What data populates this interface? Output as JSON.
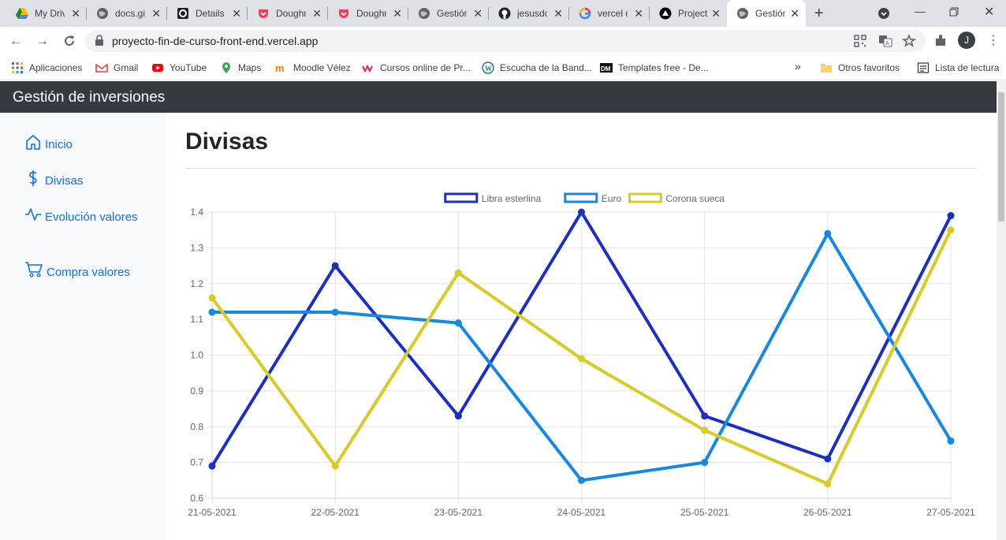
{
  "tabs": [
    {
      "title": "My Drive - Google Drive",
      "icon": "google-drive-icon"
    },
    {
      "title": "docs.github.com",
      "icon": "globe-icon"
    },
    {
      "title": "Details",
      "icon": "settings-icon"
    },
    {
      "title": "Doughnut",
      "icon": "pocket-icon"
    },
    {
      "title": "Doughnut",
      "icon": "pocket-icon"
    },
    {
      "title": "Gestión",
      "icon": "globe-icon"
    },
    {
      "title": "jesusdc",
      "icon": "github-icon"
    },
    {
      "title": "vercel deploy",
      "icon": "google-icon"
    },
    {
      "title": "Project",
      "icon": "vercel-icon"
    },
    {
      "title": "Gestión de inversiones",
      "icon": "globe-icon"
    }
  ],
  "browser": {
    "url": "proyecto-fin-de-curso-front-end.vercel.app",
    "profile_initial": "J"
  },
  "bookmarks": {
    "items": [
      {
        "label": "Aplicaciones",
        "icon": "apps-grid-icon"
      },
      {
        "label": "Gmail",
        "icon": "gmail-icon"
      },
      {
        "label": "YouTube",
        "icon": "youtube-icon"
      },
      {
        "label": "Maps",
        "icon": "maps-icon"
      },
      {
        "label": "Moodle Vélez",
        "icon": "moodle-icon"
      },
      {
        "label": "Cursos online de Pr...",
        "icon": "openwebinars-icon"
      },
      {
        "label": "Escucha de la Band...",
        "icon": "wordpress-icon"
      },
      {
        "label": "Templates free - De...",
        "icon": "dm-icon"
      }
    ],
    "more": "»",
    "other": "Otros favoritos",
    "reading": "Lista de lectura"
  },
  "app": {
    "brand": "Gestión de inversiones",
    "nav": [
      {
        "label": "Inicio",
        "icon": "house-icon"
      },
      {
        "label": "Divisas",
        "icon": "dollar-icon"
      },
      {
        "label": "Evolución valores",
        "icon": "activity-icon"
      },
      {
        "label": "Compra valores",
        "icon": "cart-icon"
      }
    ],
    "page_title": "Divisas"
  },
  "chart_data": {
    "type": "line",
    "categories": [
      "21-05-2021",
      "22-05-2021",
      "23-05-2021",
      "24-05-2021",
      "25-05-2021",
      "26-05-2021",
      "27-05-2021"
    ],
    "series": [
      {
        "name": "Libra esterlina",
        "color": "#1b2ec8",
        "values": [
          0.69,
          1.25,
          0.83,
          1.4,
          0.83,
          0.71,
          1.39
        ]
      },
      {
        "name": "Euro",
        "color": "#1388e6",
        "values": [
          1.12,
          1.12,
          1.09,
          0.65,
          0.7,
          1.34,
          0.76
        ]
      },
      {
        "name": "Corona sueca",
        "color": "#d9cc21",
        "values": [
          1.16,
          0.69,
          1.23,
          0.99,
          0.79,
          0.64,
          1.35
        ]
      }
    ],
    "yticks": [
      "0.6",
      "0.7",
      "0.8",
      "0.9",
      "1.0",
      "1.1",
      "1.2",
      "1.3",
      "1.4"
    ],
    "ylim": [
      0.6,
      1.4
    ],
    "grid": true,
    "legend": "top-center"
  }
}
